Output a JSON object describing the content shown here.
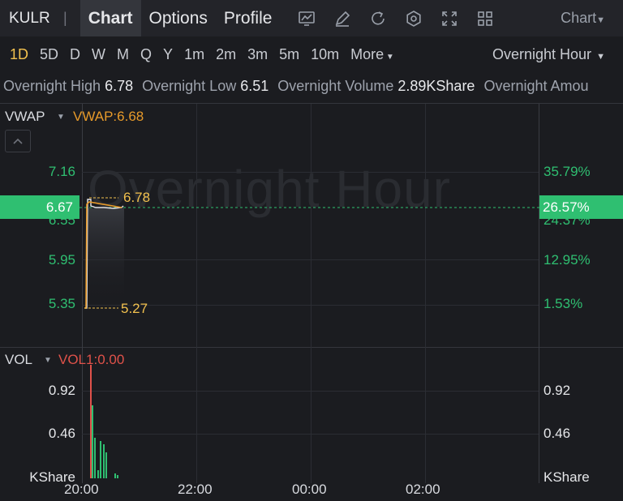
{
  "header": {
    "ticker": "KULR",
    "separator": "|",
    "tabs": [
      {
        "label": "Chart",
        "active": true
      },
      {
        "label": "Options",
        "active": false
      },
      {
        "label": "Profile",
        "active": false
      }
    ],
    "tool_icons": [
      "chart-type-icon",
      "draw-icon",
      "refresh-icon",
      "settings-icon",
      "fullscreen-icon",
      "layout-grid-icon"
    ],
    "chart_dropdown": "Chart"
  },
  "periods": {
    "items": [
      "1D",
      "5D",
      "D",
      "W",
      "M",
      "Q",
      "Y",
      "1m",
      "2m",
      "3m",
      "5m",
      "10m",
      "More"
    ],
    "active": "1D",
    "session": "Overnight Hour"
  },
  "stats": {
    "high_label": "Overnight High",
    "high_value": "6.78",
    "low_label": "Overnight Low",
    "low_value": "6.51",
    "volume_label": "Overnight Volume",
    "volume_value": "2.89KShare",
    "amount_label": "Overnight Amou"
  },
  "price_panel": {
    "indicator": "VWAP",
    "indicator_value": "VWAP:6.68",
    "watermark": "Overnight Hour",
    "left_axis": [
      "7.16",
      "6.55",
      "5.95",
      "5.35"
    ],
    "right_axis": [
      "35.79%",
      "24.37%",
      "12.95%",
      "1.53%"
    ],
    "current_price": "6.67",
    "current_pct": "26.57%",
    "high_annotation": "6.78",
    "low_annotation": "5.27"
  },
  "volume_panel": {
    "indicator": "VOL",
    "indicator_value": "VOL1:0.00",
    "left_axis": [
      "0.92",
      "0.46",
      "KShare"
    ],
    "right_axis": [
      "0.92",
      "0.46",
      "KShare"
    ]
  },
  "time_axis": [
    "20:00",
    "22:00",
    "00:00",
    "02:00"
  ],
  "colors": {
    "up": "#2fbf71",
    "accent": "#f2c14e",
    "vwap": "#e79a2a",
    "down": "#e0524a"
  }
}
